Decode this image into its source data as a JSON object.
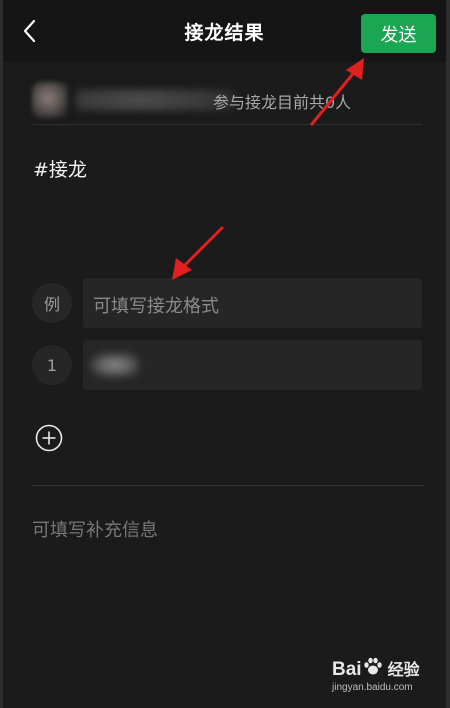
{
  "header": {
    "title": "接龙结果",
    "send_label": "发送"
  },
  "participants": {
    "summary": "参与接龙目前共0人"
  },
  "topic": "#接龙",
  "example_row": {
    "badge": "例",
    "placeholder": "可填写接龙格式"
  },
  "entries": [
    {
      "index": "1"
    }
  ],
  "supplement_placeholder": "可填写补充信息",
  "watermark": {
    "brand_left": "Bai",
    "brand_right": "经验",
    "url": "jingyan.baidu.com"
  },
  "colors": {
    "accent": "#1ba653",
    "annotation_arrow": "#e02020",
    "background": "#1b1b1b"
  }
}
